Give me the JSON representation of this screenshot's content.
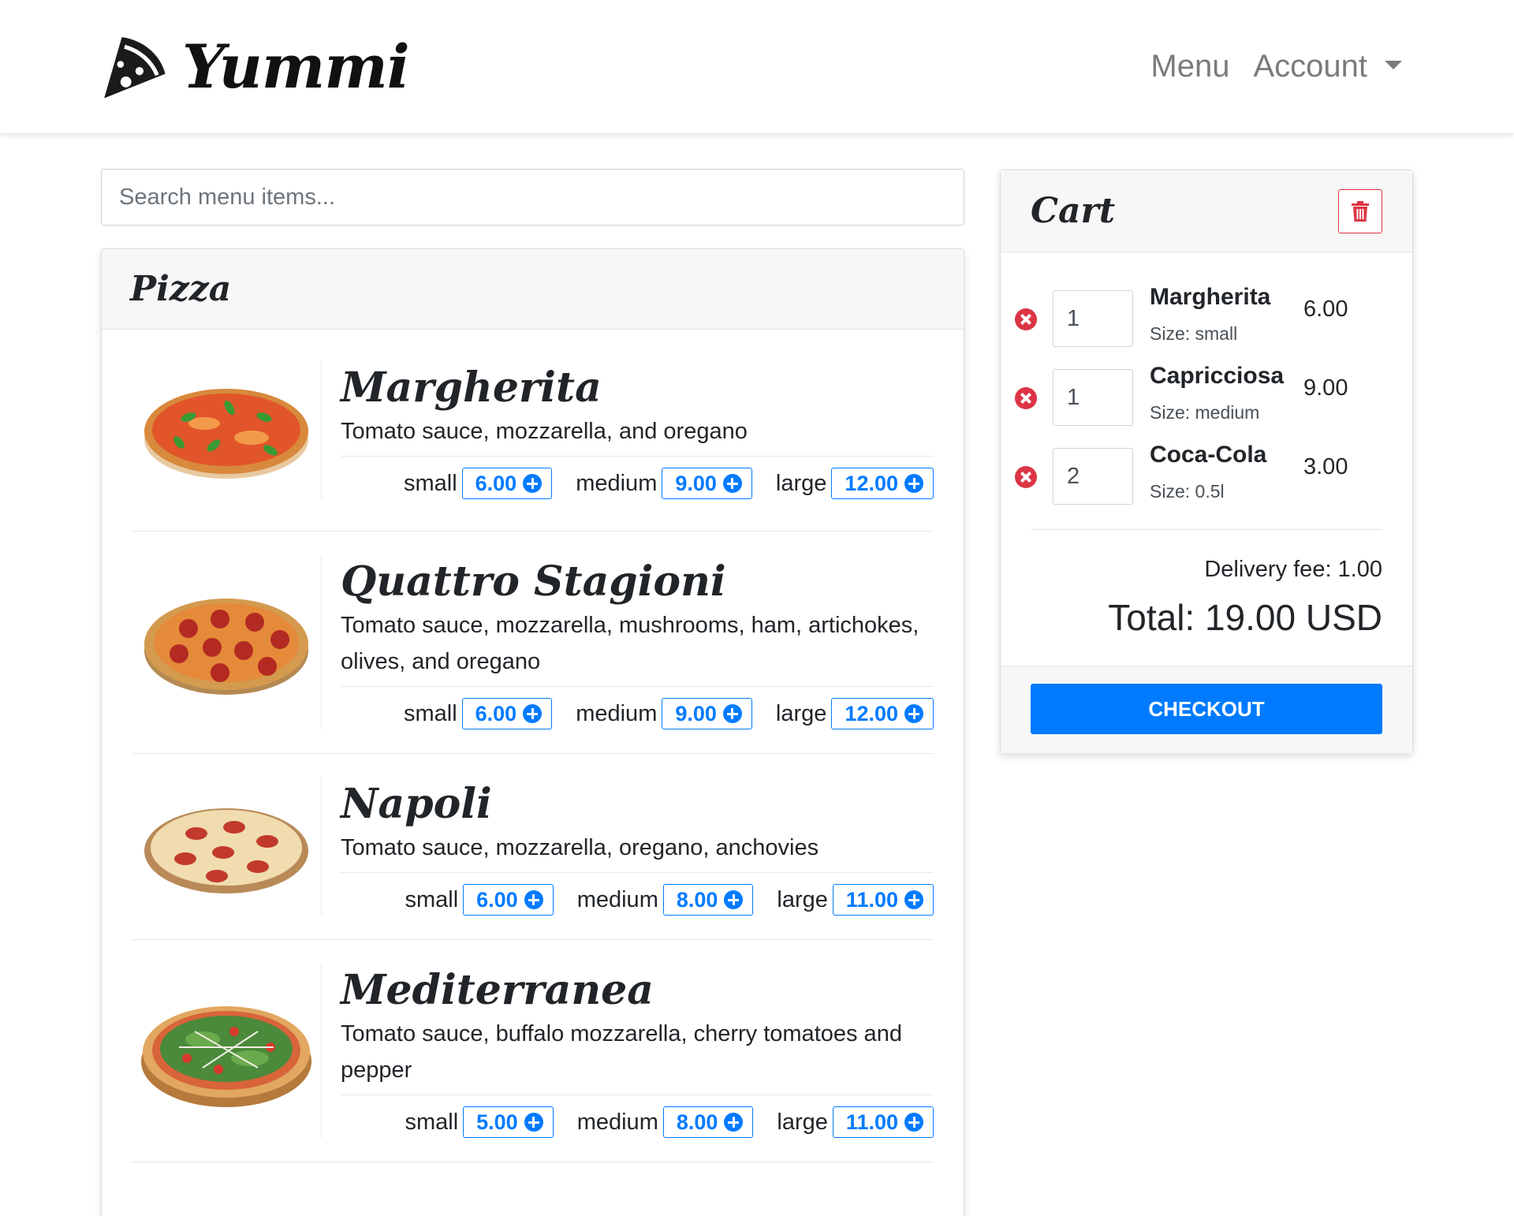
{
  "navbar": {
    "brand_name": "Yummi",
    "logo_icon": "pizza-slice-icon",
    "links": [
      "Menu",
      "Account"
    ]
  },
  "search": {
    "placeholder": "Search menu items..."
  },
  "menu": {
    "category": "Pizza",
    "items": [
      {
        "title": "Margherita",
        "description": "Tomato sauce, mozzarella, and oregano",
        "sizes": [
          {
            "label": "small",
            "price": "6.00"
          },
          {
            "label": "medium",
            "price": "9.00"
          },
          {
            "label": "large",
            "price": "12.00"
          }
        ]
      },
      {
        "title": "Quattro Stagioni",
        "description": "Tomato sauce, mozzarella, mushrooms, ham, artichokes, olives, and oregano",
        "sizes": [
          {
            "label": "small",
            "price": "6.00"
          },
          {
            "label": "medium",
            "price": "9.00"
          },
          {
            "label": "large",
            "price": "12.00"
          }
        ]
      },
      {
        "title": "Napoli",
        "description": "Tomato sauce, mozzarella, oregano, anchovies",
        "sizes": [
          {
            "label": "small",
            "price": "6.00"
          },
          {
            "label": "medium",
            "price": "8.00"
          },
          {
            "label": "large",
            "price": "11.00"
          }
        ]
      },
      {
        "title": "Mediterranea",
        "description": "Tomato sauce, buffalo mozzarella, cherry tomatoes and pepper",
        "sizes": [
          {
            "label": "small",
            "price": "5.00"
          },
          {
            "label": "medium",
            "price": "8.00"
          },
          {
            "label": "large",
            "price": "11.00"
          }
        ]
      }
    ]
  },
  "cart": {
    "title": "Cart",
    "items": [
      {
        "qty": "1",
        "name": "Margherita",
        "size": "Size: small",
        "price": "6.00"
      },
      {
        "qty": "1",
        "name": "Capricciosa",
        "size": "Size: medium",
        "price": "9.00"
      },
      {
        "qty": "2",
        "name": "Coca-Cola",
        "size": "Size: 0.5l",
        "price": "3.00"
      }
    ],
    "delivery_fee": "Delivery fee: 1.00",
    "total": "Total: 19.00 USD",
    "checkout_label": "CHECKOUT"
  },
  "colors": {
    "primary": "#007bff",
    "danger": "#dc3545",
    "header_bg": "#f7f7f7",
    "nav_link": "#7b7b7b"
  }
}
